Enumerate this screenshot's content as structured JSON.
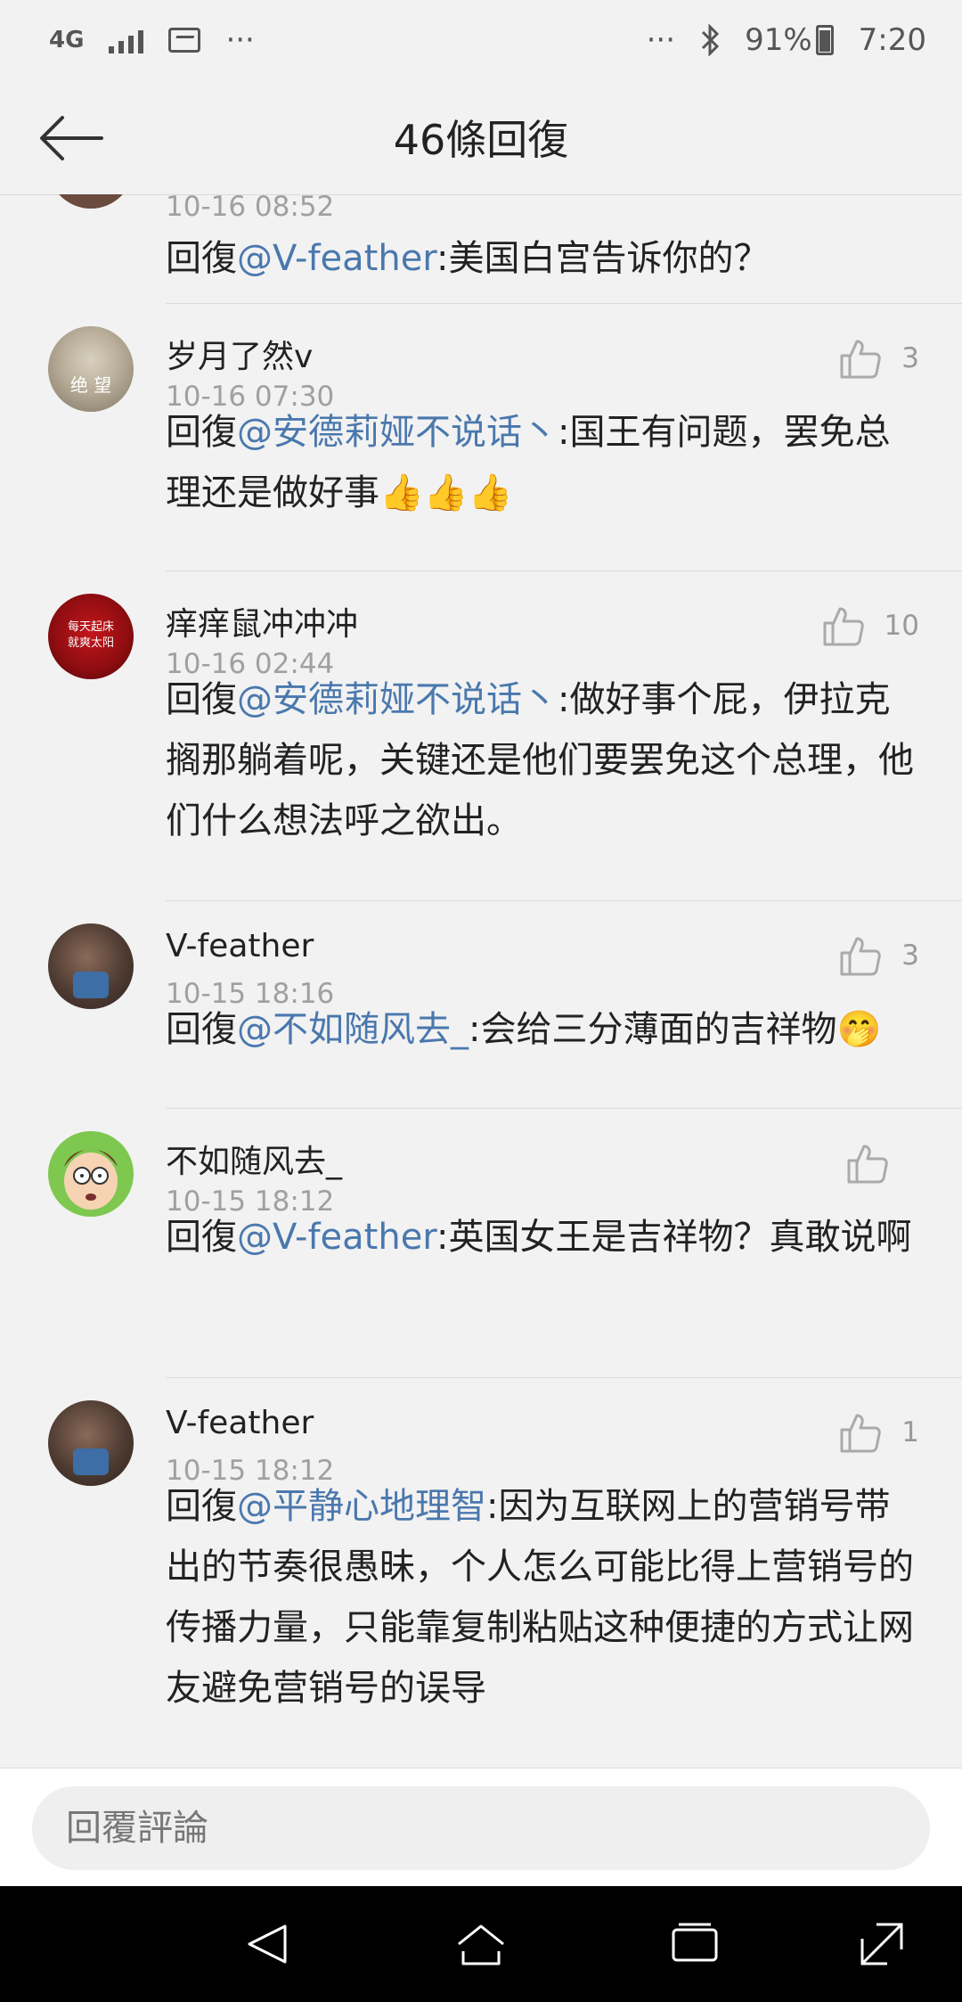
{
  "status_bar": {
    "network": "4G",
    "battery": "91%",
    "time": "7:20",
    "more_left": "···",
    "more_right": "···"
  },
  "header": {
    "title": "46條回復",
    "back_icon": "arrow-left-icon"
  },
  "comments": [
    {
      "time": "10-16 08:52",
      "reply_prefix": "回復",
      "mention": "@V-feather",
      "text": ":美国白宫告诉你的？"
    },
    {
      "username": "岁月了然v",
      "time": "10-16 07:30",
      "likes": "3",
      "reply_prefix": "回復",
      "mention": "@安德莉娅不说话丶",
      "text": ":国王有问题，罢免总理还是做好事",
      "emoji": "👍👍👍",
      "avatar_text": "绝 望"
    },
    {
      "username": "痒痒鼠冲冲冲",
      "time": "10-16 02:44",
      "likes": "10",
      "reply_prefix": "回復",
      "mention": "@安德莉娅不说话丶",
      "text": ":做好事个屁，伊拉克搁那躺着呢，关键还是他们要罢免这个总理，他们什么想法呼之欲出。",
      "avatar_text_1": "每天起床",
      "avatar_text_2": "就爽太阳"
    },
    {
      "username": "V-feather",
      "time": "10-15 18:16",
      "likes": "3",
      "reply_prefix": "回復",
      "mention": "@不如随风去_",
      "text": ":会给三分薄面的吉祥物",
      "emoji": "🤭"
    },
    {
      "username": "不如随风去_",
      "time": "10-15 18:12",
      "likes": "",
      "reply_prefix": "回復",
      "mention": "@V-feather",
      "text": ":英国女王是吉祥物？真敢说啊"
    },
    {
      "username": "V-feather",
      "time": "10-15 18:12",
      "likes": "1",
      "reply_prefix": "回復",
      "mention": "@平静心地理智",
      "text": ":因为互联网上的营销号带出的节奏很愚昧，个人怎么可能比得上营销号的传播力量，只能靠复制粘贴这种便捷的方式让网友避免营销号的误导"
    }
  ],
  "input": {
    "placeholder": "回覆評論"
  },
  "nav": {
    "back": "nav-back-icon",
    "home": "nav-home-icon",
    "recents": "nav-recents-icon",
    "expand": "nav-expand-icon"
  },
  "colors": {
    "mention": "#4a78ad",
    "background": "#f2f2f2",
    "nav_bg": "#000000"
  }
}
